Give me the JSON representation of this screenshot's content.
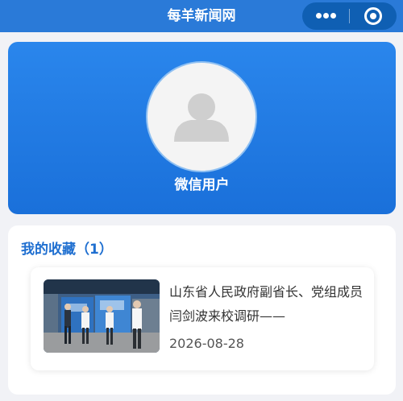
{
  "nav": {
    "title": "每羊新闻网",
    "more_icon": "more-dots-icon",
    "close_icon": "target-close-icon"
  },
  "profile": {
    "avatar_icon": "default-user-avatar-icon",
    "username": "微信用户"
  },
  "favorites": {
    "heading": "我的收藏（1）",
    "items": [
      {
        "title": "山东省人民政府副省长、党组成员闫剑波来校调研——",
        "date": "2026-08-28",
        "thumbnail": "news-photo-visit-exhibition"
      }
    ]
  },
  "colors": {
    "nav_bar": "#2a7ad8",
    "capsule": "#0f5fb3",
    "profile_card": "#1a70da",
    "heading_blue": "#1f6fd0",
    "page_bg": "#f1f2f6"
  }
}
